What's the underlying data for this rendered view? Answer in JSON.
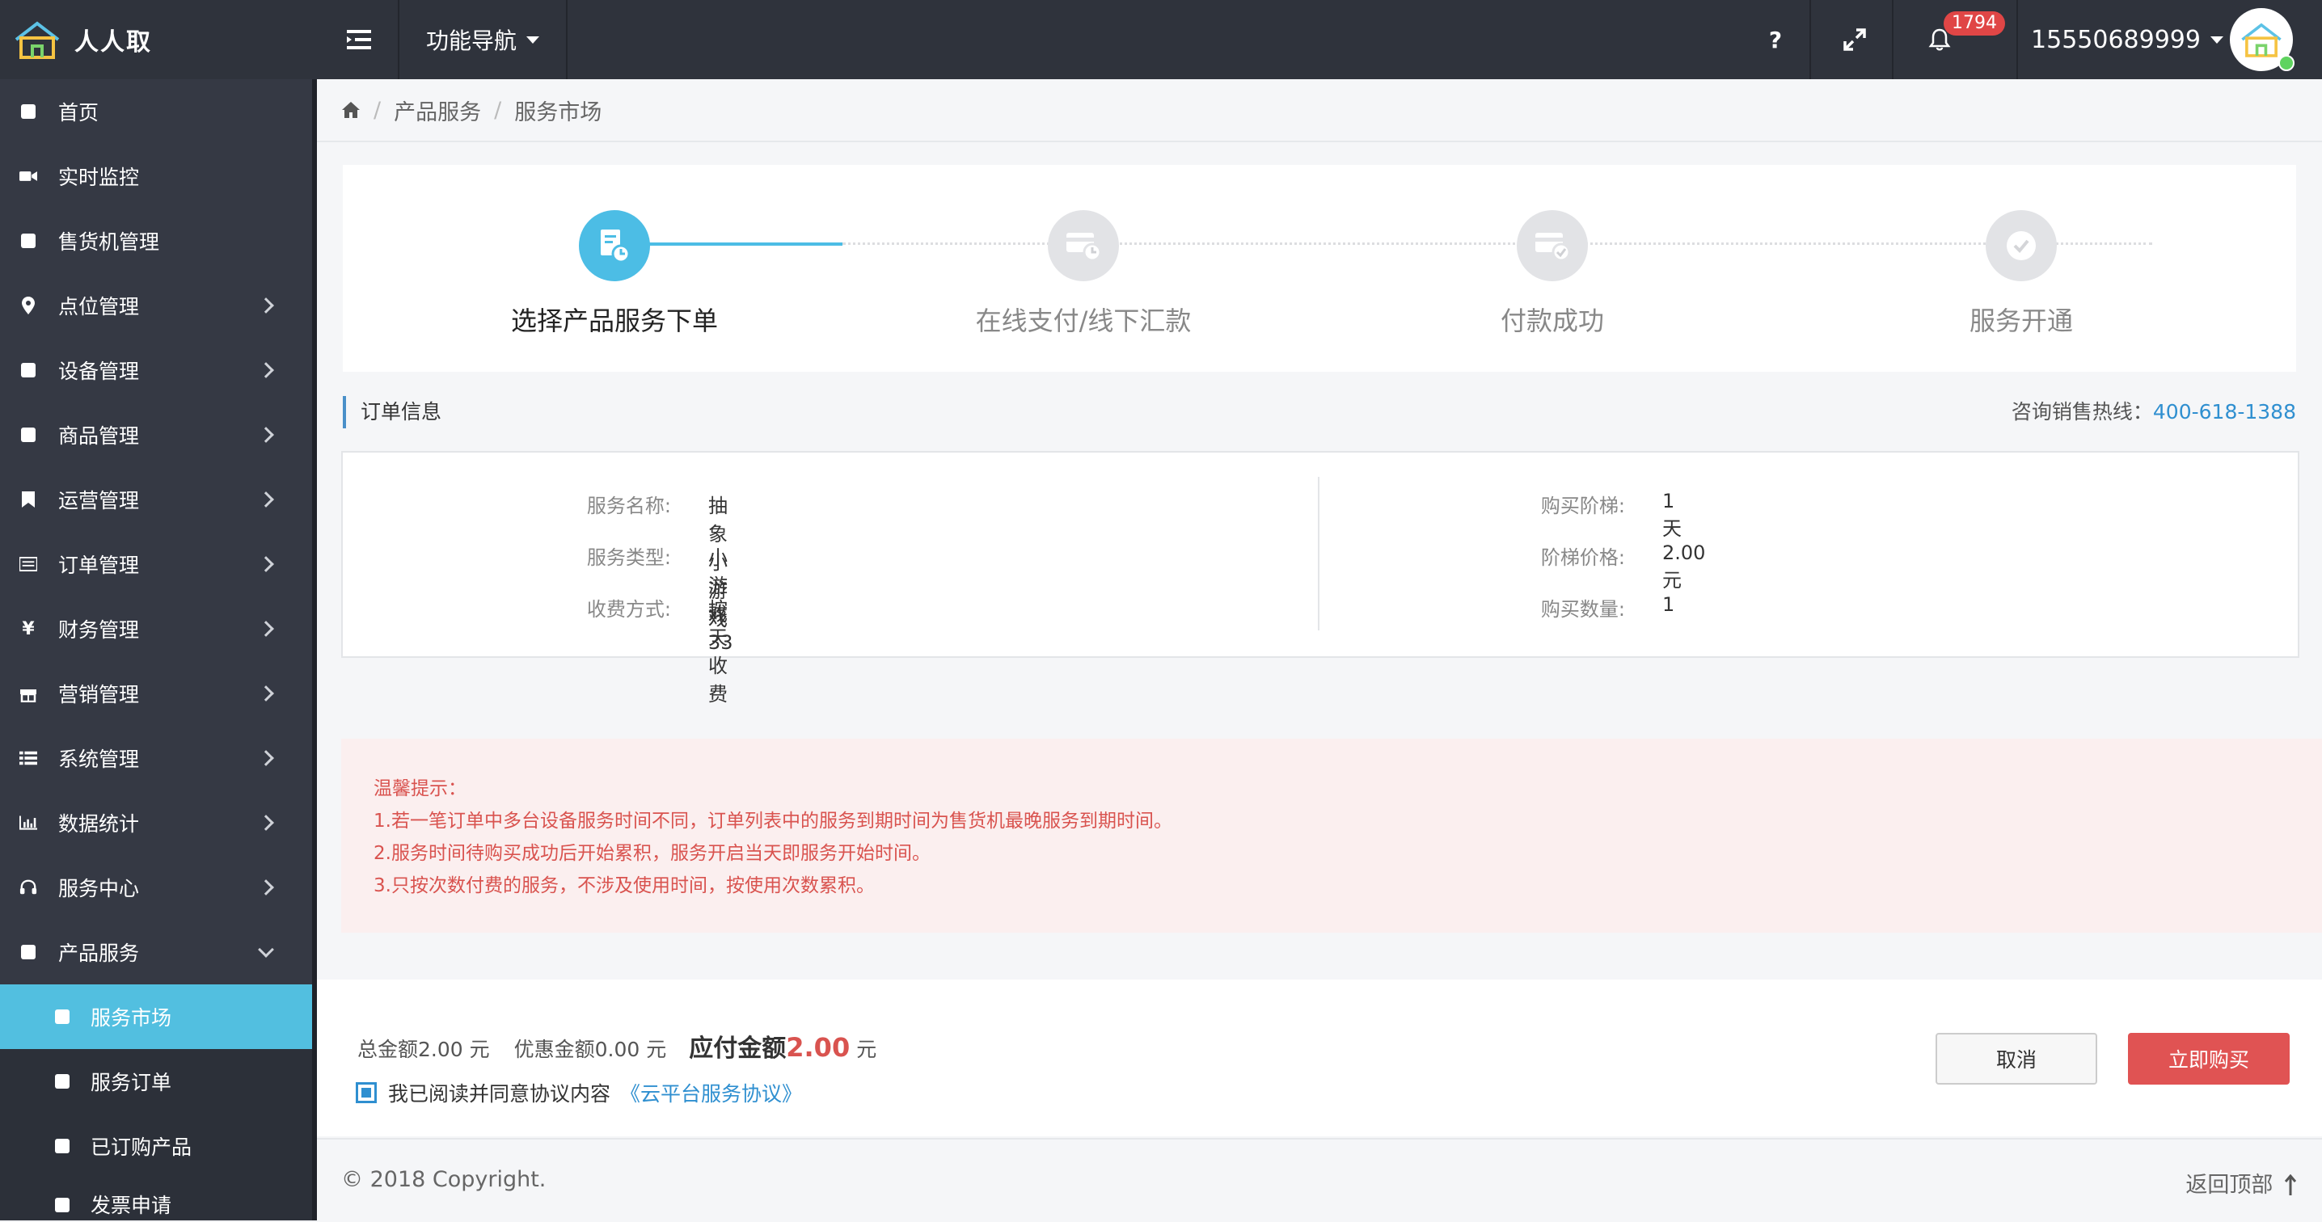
{
  "app": {
    "name": "人人取"
  },
  "topbar": {
    "nav_label": "功能导航",
    "help_label": "?",
    "notification_count": "1794",
    "user_phone": "15550689999"
  },
  "sidebar": {
    "items": [
      {
        "label": "首页",
        "icon": "square-icon"
      },
      {
        "label": "实时监控",
        "icon": "video-camera-icon"
      },
      {
        "label": "售货机管理",
        "icon": "square-icon"
      },
      {
        "label": "点位管理",
        "icon": "map-marker-icon"
      },
      {
        "label": "设备管理",
        "icon": "square-icon"
      },
      {
        "label": "商品管理",
        "icon": "square-icon"
      },
      {
        "label": "运营管理",
        "icon": "bookmark-icon"
      },
      {
        "label": "订单管理",
        "icon": "list-icon"
      },
      {
        "label": "财务管理",
        "icon": "yen-icon"
      },
      {
        "label": "营销管理",
        "icon": "gift-icon"
      },
      {
        "label": "系统管理",
        "icon": "list-icon"
      },
      {
        "label": "数据统计",
        "icon": "bar-chart-icon"
      },
      {
        "label": "服务中心",
        "icon": "headset-icon"
      },
      {
        "label": "产品服务",
        "icon": "square-icon"
      }
    ],
    "sub_items": [
      {
        "label": "服务市场",
        "active": true
      },
      {
        "label": "服务订单"
      },
      {
        "label": "已订购产品"
      },
      {
        "label": "发票申请"
      }
    ]
  },
  "breadcrumb": {
    "items": [
      "产品服务",
      "服务市场"
    ]
  },
  "steps": [
    {
      "label": "选择产品服务下单",
      "active": true
    },
    {
      "label": "在线支付/线下汇款"
    },
    {
      "label": "付款成功"
    },
    {
      "label": "服务开通"
    }
  ],
  "order": {
    "section_title": "订单信息",
    "hotline_label": "咨询销售热线：",
    "hotline_number": "400-618-1388",
    "left": [
      {
        "key": "服务名称:",
        "value": "抽象小游戏33"
      },
      {
        "key": "服务类型:",
        "value": "小游戏"
      },
      {
        "key": "收费方式:",
        "value": "按天收费"
      }
    ],
    "right": [
      {
        "key": "购买阶梯:",
        "value": "1 天"
      },
      {
        "key": "阶梯价格:",
        "value": "2.00 元"
      },
      {
        "key": "购买数量:",
        "value": "1"
      }
    ]
  },
  "notice": {
    "lines": [
      "温馨提示：",
      "1.若一笔订单中多台设备服务时间不同，订单列表中的服务到期时间为售货机最晚服务到期时间。",
      "2.服务时间待购买成功后开始累积，服务开启当天即服务开始时间。",
      "3.只按次数付费的服务，不涉及使用时间，按使用次数累积。"
    ]
  },
  "purchase": {
    "total_text": "总金额2.00 元",
    "discount_text": "优惠金额0.00 元",
    "pay_label": "应付金额",
    "pay_amount": "2.00",
    "pay_unit": "元",
    "agree_text": "我已阅读并同意协议内容",
    "agree_link": "《云平台服务协议》",
    "agree_checked": true,
    "cancel_label": "取消",
    "buy_label": "立即购买"
  },
  "footer": {
    "copyright": "© 2018 Copyright.",
    "back_to_top": "返回顶部"
  },
  "colors": {
    "topbar": "#2f333c",
    "sidebar": "#353944",
    "active": "#52bfe0",
    "accent": "#4cbde5",
    "danger": "#e05353",
    "link": "#2f8fd0"
  }
}
